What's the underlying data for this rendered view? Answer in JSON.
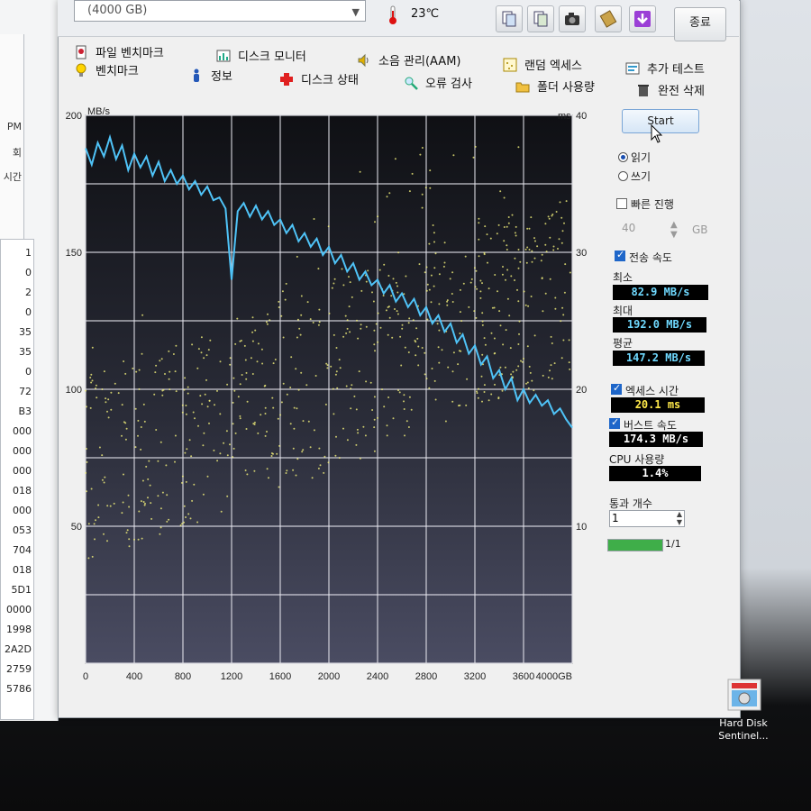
{
  "header": {
    "drive_label": "(4000 GB)",
    "temperature": "23℃",
    "exit_label": "종료"
  },
  "toolbar_icons": [
    "copy-text-icon",
    "copy-clipboard-icon",
    "camera-icon",
    "save-icon",
    "download-icon"
  ],
  "menu": {
    "row1": [
      "파일 벤치마크",
      "디스크 모니터",
      "소음 관리(AAM)",
      "랜덤 엑세스",
      "추가 테스트"
    ],
    "row2": [
      "벤치마크",
      "정보",
      "디스크 상태",
      "오류 검사",
      "폴더 사용량",
      "완전 삭제"
    ]
  },
  "controls": {
    "start_label": "Start",
    "read_label": "읽기",
    "write_label": "쓰기",
    "quick_label": "빠른 진행",
    "quick_value": "40",
    "quick_unit": "GB",
    "transfer_label": "전송 속도",
    "min_label": "최소",
    "min_value": "82.9 MB/s",
    "max_label": "최대",
    "max_value": "192.0 MB/s",
    "avg_label": "평균",
    "avg_value": "147.2 MB/s",
    "access_label": "엑세스 시간",
    "access_value": "20.1 ms",
    "burst_label": "버스트 속도",
    "burst_value": "174.3 MB/s",
    "cpu_label": "CPU 사용량",
    "cpu_value": "1.4%",
    "pass_label": "통과 개수",
    "pass_value": "1",
    "pass_progress_text": "1/1",
    "pass_progress": 1.0
  },
  "left_panel": {
    "top_fragments": [
      "PM",
      "회",
      "시간"
    ],
    "list_values": [
      "1",
      "0",
      "2",
      "0",
      "35",
      "35",
      "0",
      "72",
      "B3",
      "000",
      "000",
      "000",
      "018",
      "000",
      "053",
      "704",
      "018",
      "5D1",
      "0000",
      "1998",
      "2A2D",
      "2759",
      "5786"
    ]
  },
  "desktop": {
    "label_line1": "Hard Disk",
    "label_line2": "Sentinel..."
  },
  "chart_data": {
    "type": "line",
    "ylabel": "MB/s",
    "y2label": "ms",
    "xunit": "GB",
    "xlim": [
      0,
      4000
    ],
    "ylim": [
      0,
      200
    ],
    "y2lim": [
      0,
      40
    ],
    "x_ticks": [
      "0",
      "400",
      "800",
      "1200",
      "1600",
      "2000",
      "2400",
      "2800",
      "3200",
      "3600",
      "4000GB"
    ],
    "y_ticks": [
      "50",
      "100",
      "150",
      "200"
    ],
    "y2_ticks": [
      "10",
      "20",
      "30",
      "40"
    ],
    "grid": true,
    "series": [
      {
        "name": "transfer rate",
        "color": "#4fc3f7",
        "x": [
          0,
          50,
          100,
          150,
          200,
          250,
          300,
          350,
          400,
          450,
          500,
          550,
          600,
          650,
          700,
          750,
          800,
          850,
          900,
          950,
          1000,
          1050,
          1100,
          1150,
          1200,
          1250,
          1300,
          1350,
          1400,
          1450,
          1500,
          1550,
          1600,
          1650,
          1700,
          1750,
          1800,
          1850,
          1900,
          1950,
          2000,
          2050,
          2100,
          2150,
          2200,
          2250,
          2300,
          2350,
          2400,
          2450,
          2500,
          2550,
          2600,
          2650,
          2700,
          2750,
          2800,
          2850,
          2900,
          2950,
          3000,
          3050,
          3100,
          3150,
          3200,
          3250,
          3300,
          3350,
          3400,
          3450,
          3500,
          3550,
          3600,
          3650,
          3700,
          3750,
          3800,
          3850,
          3900,
          3950,
          4000
        ],
        "values": [
          188,
          182,
          190,
          185,
          192,
          184,
          189,
          180,
          186,
          181,
          185,
          178,
          183,
          176,
          180,
          175,
          178,
          173,
          176,
          171,
          174,
          169,
          170,
          166,
          140,
          165,
          168,
          163,
          167,
          162,
          165,
          160,
          162,
          157,
          160,
          154,
          157,
          152,
          155,
          149,
          152,
          146,
          149,
          143,
          146,
          140,
          143,
          138,
          140,
          135,
          138,
          132,
          135,
          130,
          133,
          127,
          130,
          124,
          127,
          121,
          124,
          117,
          120,
          113,
          116,
          109,
          112,
          104,
          107,
          100,
          104,
          96,
          100,
          95,
          98,
          94,
          96,
          91,
          93,
          89,
          86
        ]
      }
    ],
    "access_scatter": "yellow dots, access time in ms (right axis), spread roughly 10–35 ms"
  }
}
